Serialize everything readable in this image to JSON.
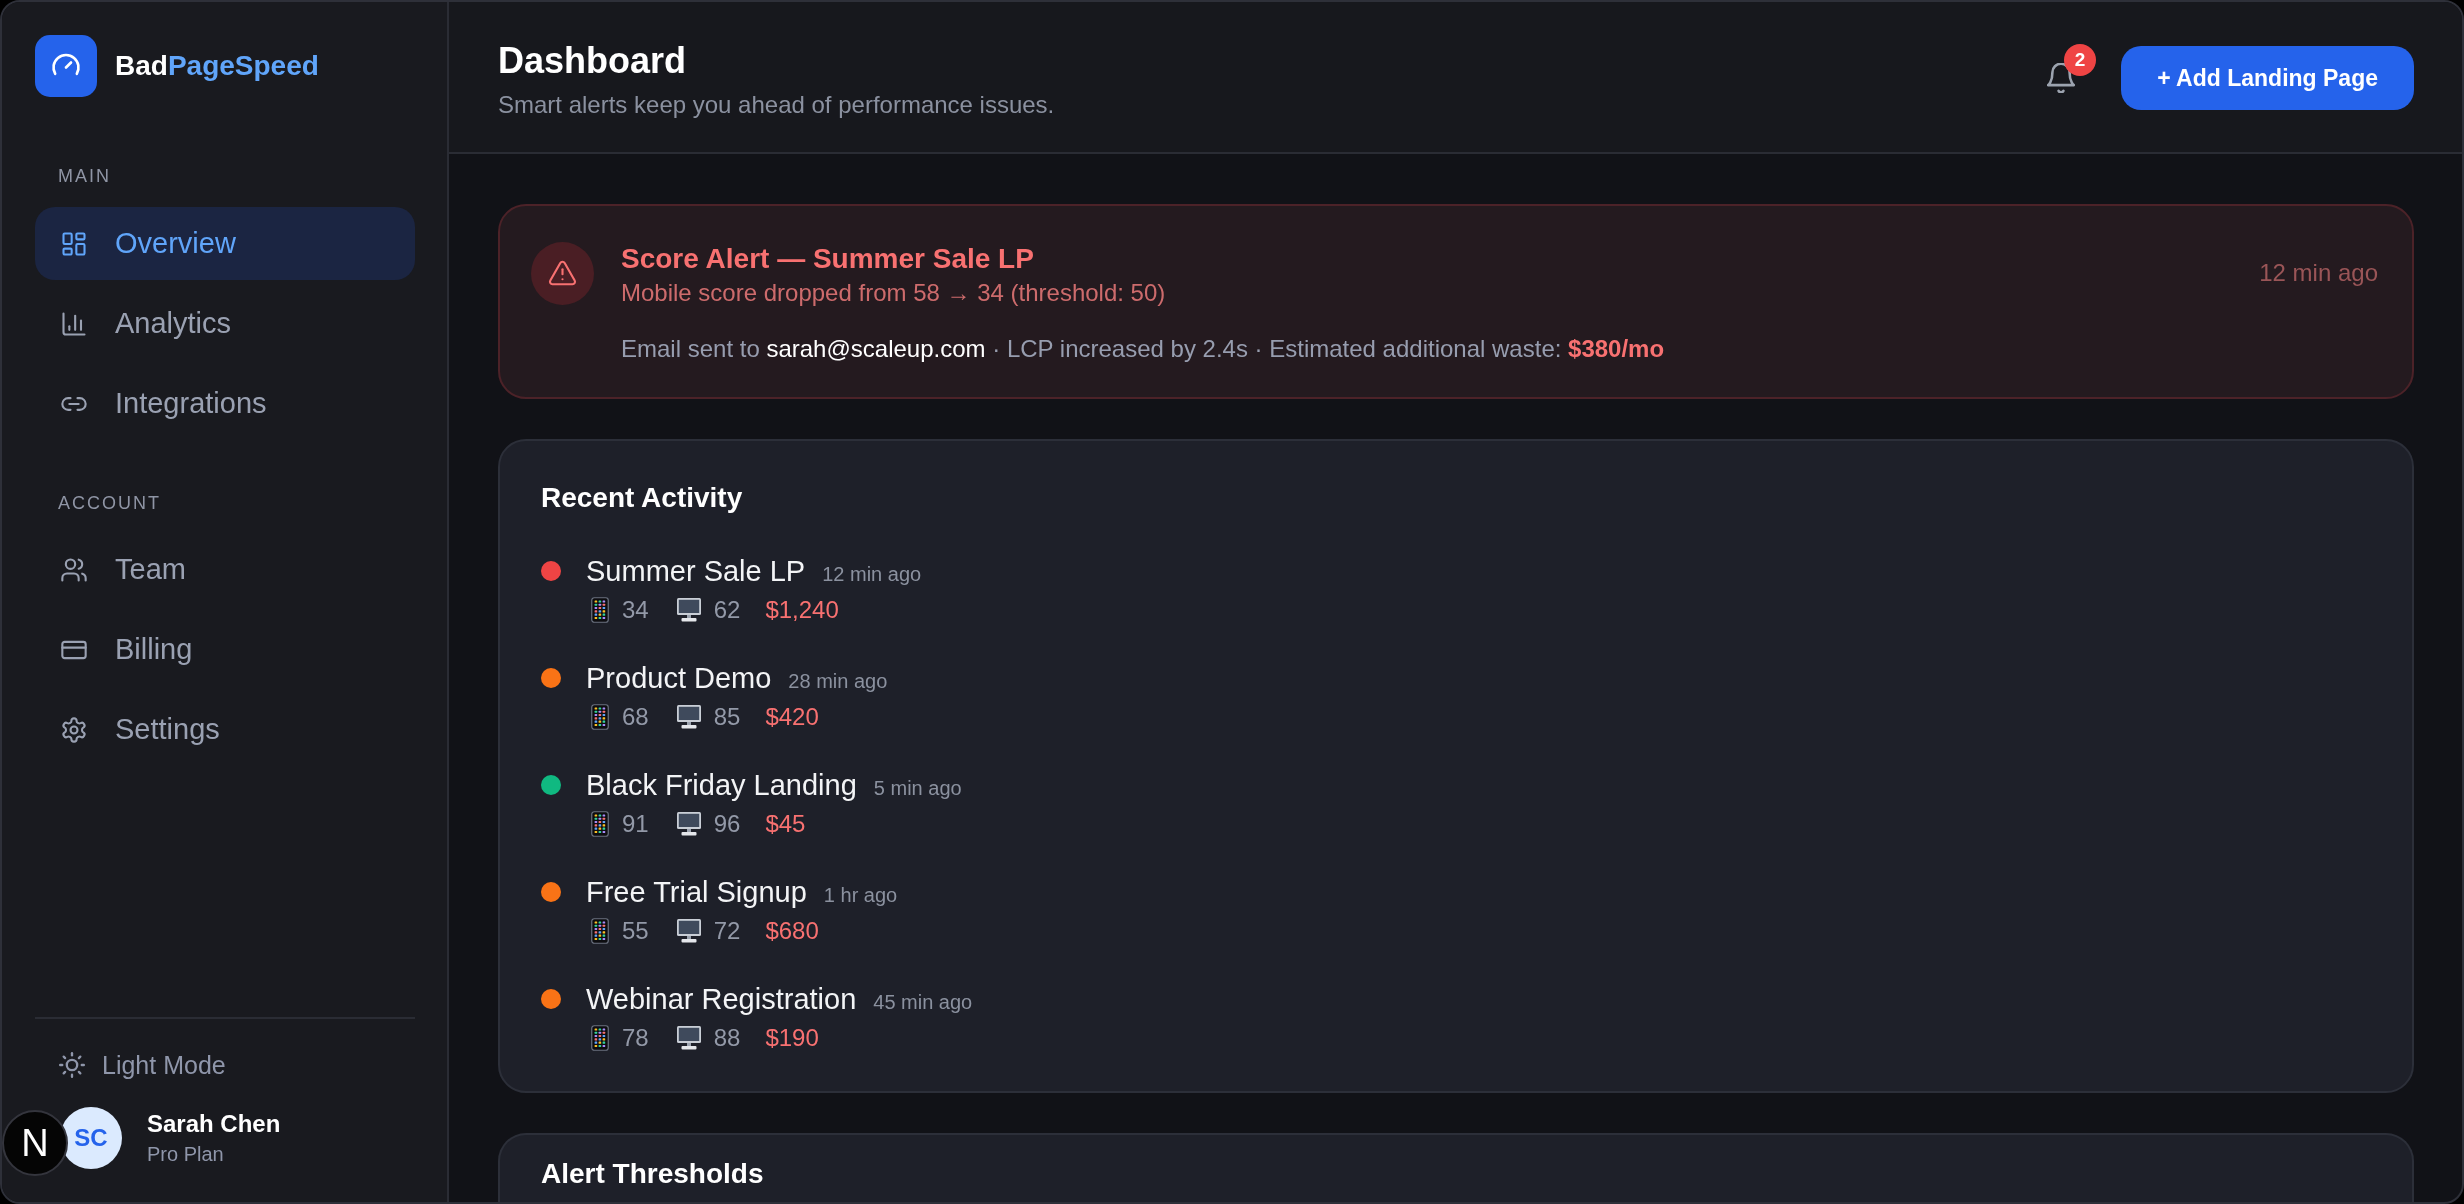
{
  "brand": {
    "name_start": "Bad",
    "name_end": "PageSpeed"
  },
  "sidebar": {
    "sections": [
      {
        "title": "MAIN",
        "items": [
          {
            "label": "Overview",
            "selected": true
          },
          {
            "label": "Analytics",
            "selected": false
          },
          {
            "label": "Integrations",
            "selected": false
          }
        ]
      },
      {
        "title": "ACCOUNT",
        "items": [
          {
            "label": "Team",
            "selected": false
          },
          {
            "label": "Billing",
            "selected": false
          },
          {
            "label": "Settings",
            "selected": false
          }
        ]
      }
    ],
    "theme_toggle": {
      "label": "Light Mode"
    },
    "user": {
      "initials": "SC",
      "name": "Sarah Chen",
      "plan": "Pro Plan"
    }
  },
  "header": {
    "title": "Dashboard",
    "subtitle": "Smart alerts keep you ahead of performance issues.",
    "notification_count": "2",
    "action_button": "+ Add Landing Page"
  },
  "score_alert": {
    "title": "Score Alert — Summer Sale LP",
    "summary": "Mobile score dropped from 58 → 34 (threshold: 50)",
    "email_prefix": "Email sent to",
    "email": "sarah@scaleup.com",
    "impact": "· LCP increased by 2.4s · Estimated additional waste:",
    "waste": "$380/mo",
    "time": "12 min ago"
  },
  "recent_activity": {
    "title": "Recent Activity",
    "items": [
      {
        "name": "Summer Sale LP",
        "time": "12 min ago",
        "mobile_score": "34",
        "desktop_score": "62",
        "waste": "$1,240",
        "color": "#ef4444"
      },
      {
        "name": "Product Demo",
        "time": "28 min ago",
        "mobile_score": "68",
        "desktop_score": "85",
        "waste": "$420",
        "color": "#f97316"
      },
      {
        "name": "Black Friday Landing",
        "time": "5 min ago",
        "mobile_score": "91",
        "desktop_score": "96",
        "waste": "$45",
        "color": "#10b981"
      },
      {
        "name": "Free Trial Signup",
        "time": "1 hr ago",
        "mobile_score": "55",
        "desktop_score": "72",
        "waste": "$680",
        "color": "#f97316"
      },
      {
        "name": "Webinar Registration",
        "time": "45 min ago",
        "mobile_score": "78",
        "desktop_score": "88",
        "waste": "$190",
        "color": "#f97316"
      }
    ]
  },
  "alert_thresholds": {
    "title": "Alert Thresholds"
  },
  "dev_tools": {
    "label": "N"
  }
}
